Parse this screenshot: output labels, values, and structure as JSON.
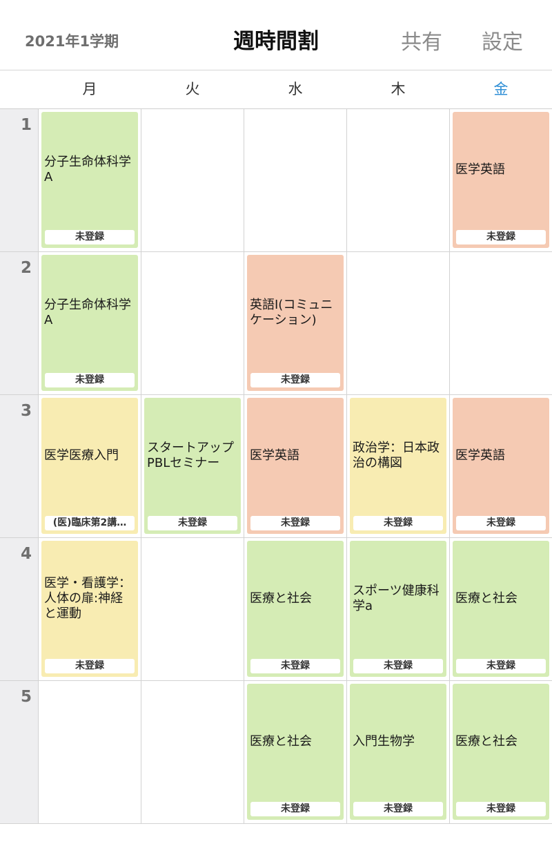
{
  "header": {
    "term": "2021年1学期",
    "title": "週時間割",
    "share_label": "共有",
    "settings_label": "設定"
  },
  "days": [
    "月",
    "火",
    "水",
    "木",
    "金"
  ],
  "colors": {
    "green": "#d5ecb5",
    "orange": "#f5cab3",
    "yellow": "#f8ecb2",
    "today": "#2f8fd6"
  },
  "periods": [
    {
      "number": "1",
      "classes": [
        {
          "name": "分子生命体科学A",
          "status": "未登録",
          "color": "green"
        },
        null,
        null,
        null,
        {
          "name": "医学英語",
          "status": "未登録",
          "color": "orange"
        }
      ]
    },
    {
      "number": "2",
      "classes": [
        {
          "name": "分子生命体科学A",
          "status": "未登録",
          "color": "green"
        },
        null,
        {
          "name": "英語I(コミュニケーション)",
          "status": "未登録",
          "color": "orange"
        },
        null,
        null
      ]
    },
    {
      "number": "3",
      "classes": [
        {
          "name": "医学医療入門",
          "status": "(医)臨床第2講…",
          "color": "yellow"
        },
        {
          "name": "スタートアップPBLセミナー",
          "status": "未登録",
          "color": "green"
        },
        {
          "name": "医学英語",
          "status": "未登録",
          "color": "orange"
        },
        {
          "name": "政治学：日本政治の構図",
          "status": "未登録",
          "color": "yellow"
        },
        {
          "name": "医学英語",
          "status": "未登録",
          "color": "orange"
        }
      ]
    },
    {
      "number": "4",
      "classes": [
        {
          "name": "医学・看護学：人体の扉:神経と運動",
          "status": "未登録",
          "color": "yellow"
        },
        null,
        {
          "name": "医療と社会",
          "status": "未登録",
          "color": "green"
        },
        {
          "name": "スポーツ健康科学a",
          "status": "未登録",
          "color": "green"
        },
        {
          "name": "医療と社会",
          "status": "未登録",
          "color": "green"
        }
      ]
    },
    {
      "number": "5",
      "classes": [
        null,
        null,
        {
          "name": "医療と社会",
          "status": "未登録",
          "color": "green"
        },
        {
          "name": "入門生物学",
          "status": "未登録",
          "color": "green"
        },
        {
          "name": "医療と社会",
          "status": "未登録",
          "color": "green"
        }
      ]
    }
  ]
}
